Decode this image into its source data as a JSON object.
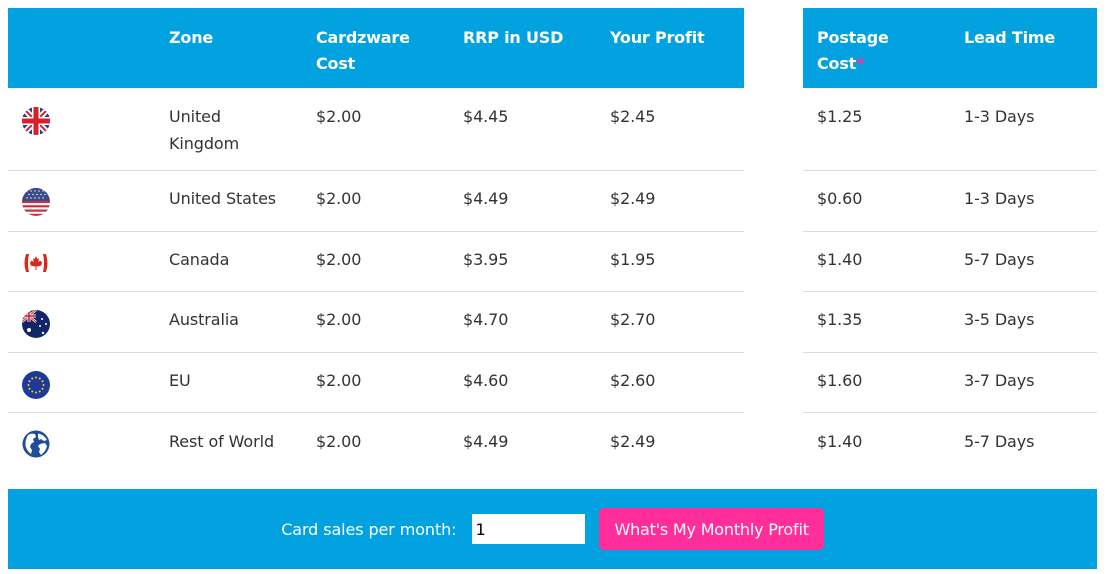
{
  "table": {
    "headers": {
      "zone": "Zone",
      "cost_line1": "Cardzware",
      "cost_line2": "Cost",
      "rrp": "RRP in USD",
      "profit": "Your Profit",
      "postage_line1": "Postage",
      "postage_line2": "Cost",
      "postage_marker": "*",
      "lead_time": "Lead Time"
    },
    "rows": [
      {
        "flag_icon": "uk-flag-icon",
        "zone_line1": "United",
        "zone_line2": "Kingdom",
        "cost": "$2.00",
        "rrp": "$4.45",
        "profit": "$2.45",
        "postage": "$1.25",
        "lead_time": "1-3 Days"
      },
      {
        "flag_icon": "us-flag-icon",
        "zone_line1": "United States",
        "zone_line2": "",
        "cost": "$2.00",
        "rrp": "$4.49",
        "profit": "$2.49",
        "postage": "$0.60",
        "lead_time": "1-3 Days"
      },
      {
        "flag_icon": "canada-flag-icon",
        "zone_line1": "Canada",
        "zone_line2": "",
        "cost": "$2.00",
        "rrp": "$3.95",
        "profit": "$1.95",
        "postage": "$1.40",
        "lead_time": "5-7 Days"
      },
      {
        "flag_icon": "australia-flag-icon",
        "zone_line1": "Australia",
        "zone_line2": "",
        "cost": "$2.00",
        "rrp": "$4.70",
        "profit": "$2.70",
        "postage": "$1.35",
        "lead_time": "3-5 Days"
      },
      {
        "flag_icon": "eu-flag-icon",
        "zone_line1": "EU",
        "zone_line2": "",
        "cost": "$2.00",
        "rrp": "$4.60",
        "profit": "$2.60",
        "postage": "$1.60",
        "lead_time": "3-7 Days"
      },
      {
        "flag_icon": "globe-icon",
        "zone_line1": "Rest of World",
        "zone_line2": "",
        "cost": "$2.00",
        "rrp": "$4.49",
        "profit": "$2.49",
        "postage": "$1.40",
        "lead_time": "5-7 Days"
      }
    ]
  },
  "calculator": {
    "label": "Card sales per month:",
    "input_value": "1",
    "button_label": "What's My Monthly Profit"
  },
  "colors": {
    "header_blue": "#02a1e0",
    "accent_pink": "#ff2e9a"
  }
}
